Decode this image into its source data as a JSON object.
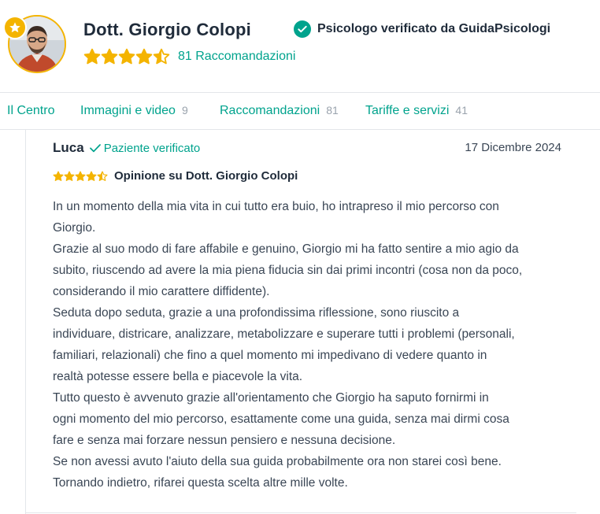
{
  "profile": {
    "name": "Dott. Giorgio Colopi",
    "verified_text": "Psicologo verificato da GuidaPsicologi",
    "rating_stars": 4.5,
    "recommendations_text": "81 Raccomandazioni",
    "accent_color": "#00a38d",
    "star_color": "#f4b400",
    "avatar_icon": "avatar-photo",
    "badge_icon": "star-icon"
  },
  "tabs": [
    {
      "label": "Il Centro",
      "count": ""
    },
    {
      "label": "Immagini e video",
      "count": "9"
    },
    {
      "label": "Raccomandazioni",
      "count": "81"
    },
    {
      "label": "Tariffe e servizi",
      "count": "41"
    }
  ],
  "review": {
    "author": "Luca",
    "patient_badge": "Paziente verificato",
    "date": "17 Dicembre 2024",
    "rating_stars": 4.5,
    "title": "Opinione su Dott. Giorgio Colopi",
    "lines": [
      "In un momento della mia vita in cui tutto era buio, ho intrapreso il mio percorso con",
      "Giorgio.",
      "Grazie al suo modo di fare affabile e genuino, Giorgio mi ha fatto sentire a mio agio da",
      "subito, riuscendo ad avere la mia piena fiducia sin dai primi incontri (cosa non da poco,",
      "considerando il mio carattere diffidente).",
      "Seduta dopo seduta, grazie a una profondissima riflessione, sono riuscito a",
      "individuare, districare, analizzare, metabolizzare e superare tutti i problemi (personali,",
      "familiari, relazionali) che fino a quel momento mi impedivano di vedere quanto in",
      "realtà potesse essere bella e piacevole la vita.",
      "Tutto questo è avvenuto grazie all'orientamento che Giorgio ha saputo fornirmi in",
      "ogni momento del mio percorso, esattamente come una guida, senza mai dirmi cosa",
      "fare e senza mai forzare nessun pensiero e nessuna decisione.",
      "Se non avessi avuto l'aiuto della sua guida probabilmente ora non starei così bene.",
      "Tornando indietro, rifarei questa scelta altre mille volte."
    ]
  }
}
